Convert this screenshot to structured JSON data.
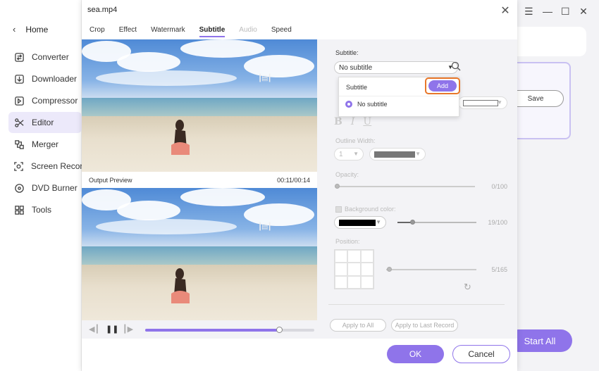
{
  "sidebar": {
    "home_label": "Home",
    "items": [
      {
        "label": "Converter",
        "icon": "converter-icon"
      },
      {
        "label": "Downloader",
        "icon": "downloader-icon"
      },
      {
        "label": "Compressor",
        "icon": "compressor-icon"
      },
      {
        "label": "Editor",
        "icon": "scissors-icon",
        "active": true
      },
      {
        "label": "Merger",
        "icon": "merger-icon"
      },
      {
        "label": "Screen Record",
        "icon": "screen-record-icon"
      },
      {
        "label": "DVD Burner",
        "icon": "disc-icon"
      },
      {
        "label": "Tools",
        "icon": "grid-icon"
      }
    ]
  },
  "background": {
    "save_label": "Save",
    "start_all_label": "Start All"
  },
  "dialog": {
    "title": "sea.mp4",
    "tabs": [
      {
        "label": "Crop"
      },
      {
        "label": "Effect"
      },
      {
        "label": "Watermark"
      },
      {
        "label": "Subtitle",
        "active": true
      },
      {
        "label": "Audio",
        "disabled": true
      },
      {
        "label": "Speed"
      }
    ],
    "preview_label": "Output Preview",
    "preview_time": "00:11/00:14",
    "playback_progress": 0.79
  },
  "subtitle_panel": {
    "subtitle_label": "Subtitle:",
    "subtitle_value": "No subtitle",
    "outline_width_label": "Outline Width:",
    "outline_width_value": "1",
    "opacity_label": "Opacity:",
    "opacity_value": "0/100",
    "background_color_label": "Background color:",
    "background_value": "19/100",
    "position_label": "Position:",
    "position_value": "5/165",
    "apply_all_label": "Apply to All",
    "apply_last_label": "Apply to Last Record"
  },
  "popup": {
    "header": "Subtitle",
    "add_label": "Add",
    "option_label": "No subtitle"
  },
  "footer": {
    "ok_label": "OK",
    "cancel_label": "Cancel"
  },
  "colors": {
    "accent": "#8f74ea",
    "highlight": "#e8772a"
  }
}
